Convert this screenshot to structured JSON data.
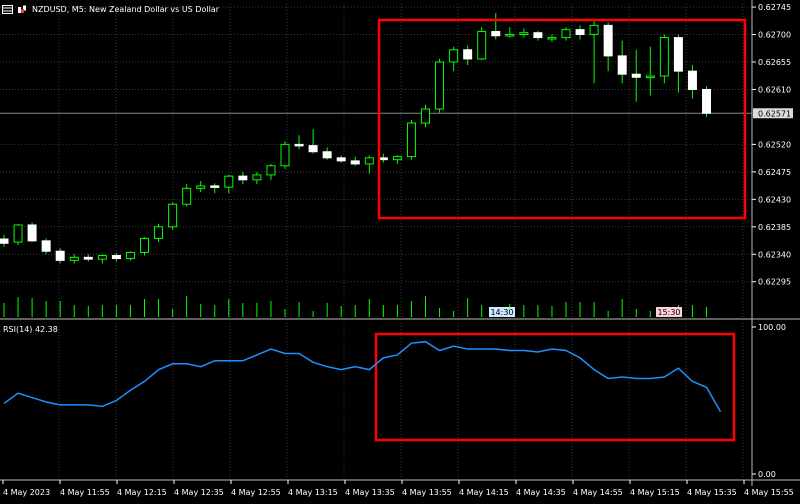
{
  "header": {
    "title": "NZDUSD, M5:  New Zealand Dollar vs US Dollar"
  },
  "rsi_label": "RSI(14) 42.38",
  "colors": {
    "background": "#000000",
    "grid": "#3a3a3a",
    "bull_body": "#ffffff",
    "bear_body": "#ffffff",
    "candle_outline": "#00ff00",
    "rsi_line": "#1e90ff",
    "highlight_box": "#ff0000",
    "current_price_line": "#8a8a8a",
    "volume": "#00ff00"
  },
  "chart_data": [
    {
      "type": "candlestick",
      "title": "NZDUSD, M5:  New Zealand Dollar vs US Dollar",
      "ylim": [
        0.6227,
        0.6275
      ],
      "price_ticks": [
        "0.62745",
        "0.62700",
        "0.62655",
        "0.62610",
        "0.62520",
        "0.62475",
        "0.62430",
        "0.62385",
        "0.62340",
        "0.62295"
      ],
      "current_price": "0.62571",
      "candles": [
        [
          0.62365,
          0.62372,
          0.62352,
          0.62358
        ],
        [
          0.6236,
          0.6239,
          0.62355,
          0.62388
        ],
        [
          0.62388,
          0.62392,
          0.6236,
          0.62362
        ],
        [
          0.62362,
          0.62366,
          0.6234,
          0.62345
        ],
        [
          0.62345,
          0.6235,
          0.62325,
          0.6233
        ],
        [
          0.6233,
          0.6234,
          0.62325,
          0.62335
        ],
        [
          0.62335,
          0.6234,
          0.62328,
          0.62332
        ],
        [
          0.62332,
          0.6234,
          0.62325,
          0.62338
        ],
        [
          0.62338,
          0.62342,
          0.62328,
          0.62333
        ],
        [
          0.62333,
          0.62345,
          0.6233,
          0.62343
        ],
        [
          0.62343,
          0.62368,
          0.62338,
          0.62366
        ],
        [
          0.62366,
          0.6239,
          0.6236,
          0.62385
        ],
        [
          0.62385,
          0.62425,
          0.6238,
          0.62422
        ],
        [
          0.62422,
          0.62455,
          0.62418,
          0.62448
        ],
        [
          0.62448,
          0.6246,
          0.62442,
          0.62452
        ],
        [
          0.62452,
          0.62456,
          0.6244,
          0.6245
        ],
        [
          0.6245,
          0.6247,
          0.6244,
          0.62468
        ],
        [
          0.62468,
          0.62475,
          0.62455,
          0.62462
        ],
        [
          0.62462,
          0.62475,
          0.62455,
          0.6247
        ],
        [
          0.6247,
          0.62488,
          0.62462,
          0.62485
        ],
        [
          0.62485,
          0.62525,
          0.6248,
          0.6252
        ],
        [
          0.6252,
          0.62535,
          0.62512,
          0.62518
        ],
        [
          0.62518,
          0.62545,
          0.62505,
          0.62508
        ],
        [
          0.62508,
          0.62515,
          0.62495,
          0.62498
        ],
        [
          0.62498,
          0.62502,
          0.6249,
          0.62493
        ],
        [
          0.62493,
          0.625,
          0.62485,
          0.62488
        ],
        [
          0.62488,
          0.62502,
          0.62472,
          0.62498
        ],
        [
          0.62498,
          0.62505,
          0.6249,
          0.62495
        ],
        [
          0.62495,
          0.62502,
          0.62488,
          0.625
        ],
        [
          0.625,
          0.6256,
          0.62495,
          0.62555
        ],
        [
          0.62555,
          0.62585,
          0.62548,
          0.62578
        ],
        [
          0.62578,
          0.6266,
          0.62572,
          0.62655
        ],
        [
          0.62655,
          0.6268,
          0.6264,
          0.62675
        ],
        [
          0.62675,
          0.62682,
          0.6265,
          0.6266
        ],
        [
          0.6266,
          0.62712,
          0.62658,
          0.62705
        ],
        [
          0.62705,
          0.62735,
          0.62692,
          0.62698
        ],
        [
          0.62698,
          0.62712,
          0.62695,
          0.627
        ],
        [
          0.627,
          0.6271,
          0.62695,
          0.62703
        ],
        [
          0.62703,
          0.62706,
          0.6269,
          0.62695
        ],
        [
          0.62695,
          0.627,
          0.62688,
          0.62695
        ],
        [
          0.62695,
          0.62712,
          0.6269,
          0.62708
        ],
        [
          0.62708,
          0.62715,
          0.62692,
          0.627
        ],
        [
          0.627,
          0.62722,
          0.6262,
          0.62715
        ],
        [
          0.62715,
          0.6272,
          0.6264,
          0.62665
        ],
        [
          0.62665,
          0.6269,
          0.6262,
          0.62635
        ],
        [
          0.62635,
          0.62675,
          0.6259,
          0.6263
        ],
        [
          0.6263,
          0.6268,
          0.626,
          0.62632
        ],
        [
          0.62632,
          0.627,
          0.6262,
          0.62695
        ],
        [
          0.62695,
          0.627,
          0.62605,
          0.6264
        ],
        [
          0.6264,
          0.6265,
          0.62595,
          0.6261
        ],
        [
          0.6261,
          0.62615,
          0.62565,
          0.62571
        ]
      ],
      "volume_label": "volume"
    },
    {
      "type": "line",
      "title": "RSI(14) 42.38",
      "ylim": [
        0,
        100
      ],
      "y_ticks": [
        "100.00",
        "0.00"
      ],
      "values": [
        48,
        55,
        52,
        49,
        47,
        47,
        47,
        46,
        50,
        57,
        63,
        71,
        75,
        75,
        73,
        77,
        77,
        77,
        81,
        85,
        82,
        82,
        76,
        73,
        71,
        73,
        71,
        79,
        81,
        89,
        90,
        84,
        87,
        85,
        85,
        85,
        84,
        84,
        83,
        85,
        84,
        79,
        71,
        65,
        66,
        65,
        65,
        66,
        72,
        63,
        59,
        42.38
      ]
    }
  ],
  "x_axis": {
    "tick_labels": [
      "4 May 2023",
      "4 May 11:55",
      "4 May 12:15",
      "4 May 12:35",
      "4 May 12:55",
      "4 May 13:15",
      "4 May 13:35",
      "4 May 13:55",
      "4 May 14:15",
      "4 May 14:35",
      "4 May 14:55",
      "4 May 15:15",
      "4 May 15:35",
      "4 May 15:55"
    ]
  },
  "time_markers": [
    "14:30",
    "15:30"
  ]
}
